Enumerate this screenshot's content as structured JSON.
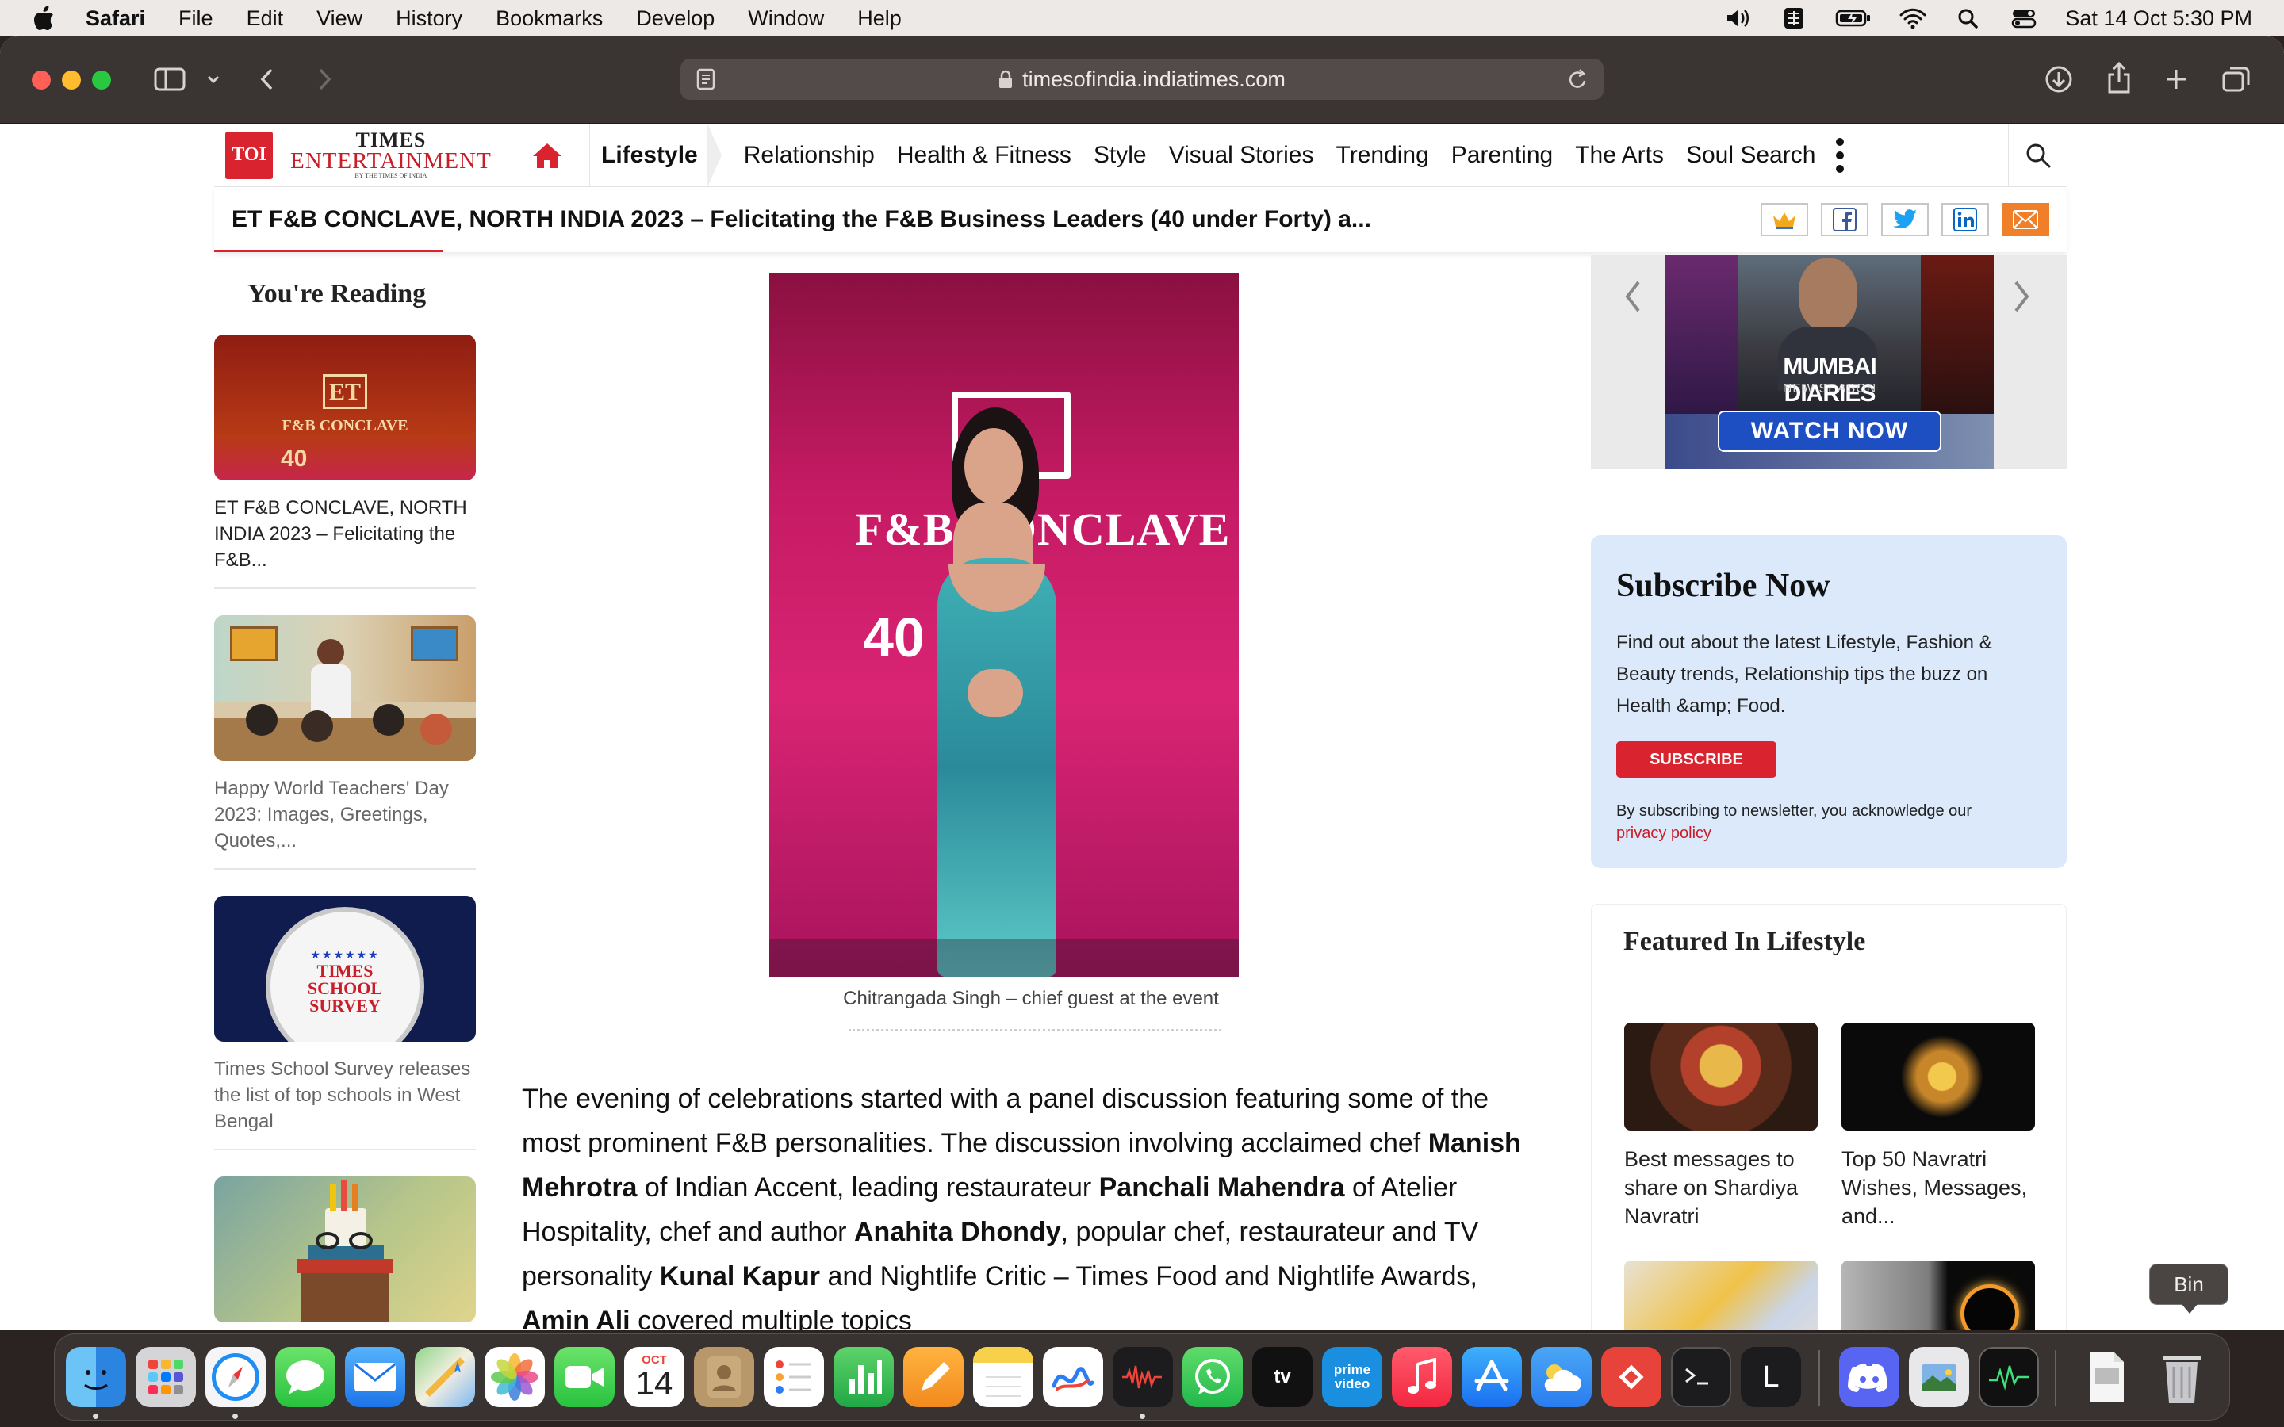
{
  "menubar": {
    "app_name": "Safari",
    "items": [
      "File",
      "Edit",
      "View",
      "History",
      "Bookmarks",
      "Develop",
      "Window",
      "Help"
    ],
    "clock": "Sat 14 Oct  5:30 PM",
    "status_icons": [
      "volume-icon",
      "keyboard-input-icon",
      "battery-icon",
      "wifi-icon",
      "spotlight-search-icon",
      "control-center-icon"
    ]
  },
  "browser": {
    "url": "timesofindia.indiatimes.com",
    "toolbar_icons": [
      "sidebar-toggle-icon",
      "chevron-down-icon",
      "back-icon",
      "forward-icon",
      "downloads-icon",
      "share-icon",
      "new-tab-icon",
      "tab-overview-icon"
    ]
  },
  "site": {
    "logo": {
      "badge": "TOI",
      "line1": "TIMES",
      "line2": "ENTERTAINMENT",
      "line3": "BY THE TIMES OF INDIA"
    },
    "section": "Lifestyle",
    "nav": [
      "Relationship",
      "Health & Fitness",
      "Style",
      "Visual Stories",
      "Trending",
      "Parenting",
      "The Arts",
      "Soul Search"
    ],
    "headline": "ET F&B CONCLAVE, NORTH INDIA 2023 – Felicitating the F&B Business Leaders (40 under Forty) a...",
    "share_icons": [
      "crown-icon",
      "facebook-icon",
      "twitter-icon",
      "linkedin-icon",
      "email-icon"
    ]
  },
  "sidebar": {
    "heading": "You're Reading",
    "cards": [
      {
        "title": "ET F&B CONCLAVE, NORTH INDIA 2023 – Felicitating the F&B...",
        "thumb_text": "F&B CONCLAVE"
      },
      {
        "title": "Happy World Teachers' Day 2023: Images, Greetings, Quotes,..."
      },
      {
        "title": "Times School Survey releases the list of top schools in West Bengal",
        "thumb_text": "TIMES SCHOOL SURVEY"
      },
      {
        "title": ""
      }
    ]
  },
  "article": {
    "hero_text": "F&B CONCLAVE",
    "caption": "Chitrangada Singh – chief guest at the event",
    "p1_a": "The evening of celebrations started with a panel discussion featuring some of the most prominent F&B personalities. The discussion involving acclaimed chef ",
    "p1_b": "Manish Mehrotra",
    "p1_c": " of Indian Accent, leading restaurateur ",
    "p1_d": "Panchali Mahendra",
    "p1_e": " of Atelier Hospitality, chef and author ",
    "p1_f": "Anahita Dhondy",
    "p1_g": ", popular chef, restaurateur and TV personality ",
    "p1_h": "Kunal Kapur",
    "p1_i": " and Nightlife Critic – Times Food and Nightlife Awards, ",
    "p1_j": "Amin Ali",
    "p1_k": " covered multiple topics"
  },
  "ad": {
    "title": "MUMBAI DIARIES",
    "subtitle": "NEW SEASON",
    "cta": "WATCH NOW"
  },
  "subscribe": {
    "heading": "Subscribe Now",
    "body": "Find out about the latest Lifestyle, Fashion & Beauty trends, Relationship tips the buzz on Health &amp; Food.",
    "button": "SUBSCRIBE",
    "note": "By subscribing to newsletter, you acknowledge our",
    "link": "privacy policy"
  },
  "featured": {
    "heading": "Featured In Lifestyle",
    "items": [
      {
        "title": "Best messages to share on Shardiya Navratri"
      },
      {
        "title": "Top 50 Navratri Wishes, Messages, and..."
      }
    ]
  },
  "dock": {
    "tooltip": "Bin",
    "calendar_month": "OCT",
    "calendar_day": "14",
    "apps": [
      "finder-icon",
      "launchpad-icon",
      "safari-icon",
      "messages-icon",
      "mail-icon",
      "maps-icon",
      "photos-icon",
      "facetime-icon",
      "calendar-icon",
      "contacts-icon",
      "reminders-icon",
      "numbers-icon",
      "pages-icon",
      "notes-icon",
      "freeform-icon",
      "voice-memos-icon",
      "whatsapp-icon",
      "apple-tv-icon",
      "prime-video-icon",
      "music-icon",
      "app-store-icon",
      "weather-icon",
      "anydesk-icon",
      "terminal-icon",
      "l-app-icon",
      "discord-icon",
      "preview-icon",
      "activity-monitor-icon",
      "document-icon",
      "trash-icon"
    ]
  },
  "colors": {
    "brand_red": "#d9232e",
    "subscribe_bg": "#dbe9fb",
    "link_red": "#c81e28"
  }
}
